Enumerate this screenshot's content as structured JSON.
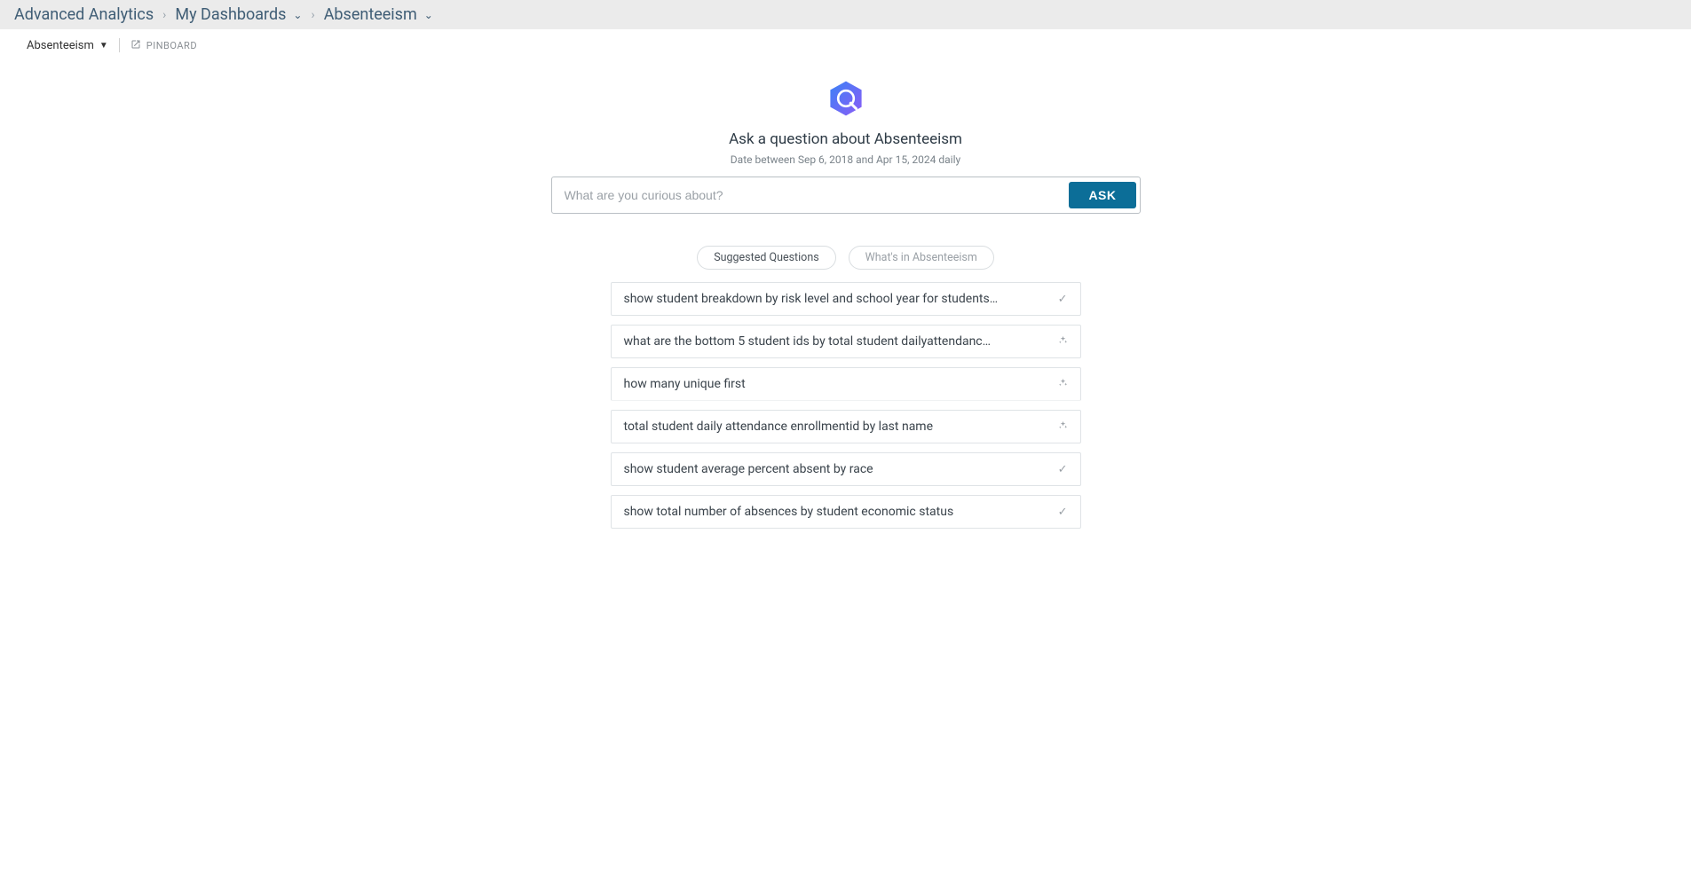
{
  "breadcrumb": {
    "root": "Advanced Analytics",
    "section": "My Dashboards",
    "page": "Absenteeism"
  },
  "toolbar": {
    "topic": "Absenteeism",
    "pinboard": "PINBOARD"
  },
  "ask": {
    "title": "Ask a question about Absenteeism",
    "subtitle": "Date between Sep 6, 2018 and Apr 15, 2024 daily",
    "placeholder": "What are you curious about?",
    "button": "ASK"
  },
  "pills": {
    "suggested": "Suggested Questions",
    "whatsin": "What's in Absenteeism"
  },
  "suggestions": [
    {
      "text": "show student breakdown by risk level and school year for students…",
      "icon": "check"
    },
    {
      "text": "what are the bottom 5 student ids by total student dailyattendanc…",
      "icon": "sparkle"
    },
    {
      "text": "how many unique first",
      "icon": "sparkle"
    },
    {
      "text": "total student daily attendance enrollmentid by last name",
      "icon": "sparkle"
    },
    {
      "text": "show student average percent absent by race",
      "icon": "check"
    },
    {
      "text": "show total number of absences by student economic status",
      "icon": "check"
    }
  ]
}
